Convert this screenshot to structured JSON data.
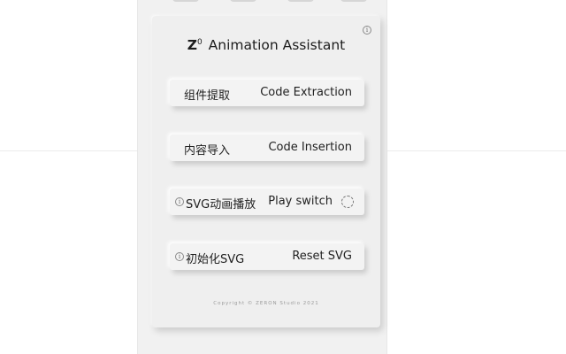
{
  "panel": {
    "logo": "Z",
    "logo_sup": "0",
    "title": "Animation Assistant",
    "info_icon": "info-icon",
    "copyright": "Copyright © ZERON Studio 2021"
  },
  "buttons": [
    {
      "cn": "组件提取",
      "en": "Code Extraction"
    },
    {
      "cn": "内容导入",
      "en": "Code Insertion"
    },
    {
      "cn": "SVG动画播放",
      "en": "Play switch",
      "icon": "info-icon",
      "toggle_icon": "spinner-icon"
    },
    {
      "cn": "初始化SVG",
      "en": "Reset SVG",
      "icon": "info-icon"
    }
  ],
  "colors": {
    "panel_bg": "#efefef",
    "text": "#1f1f1f",
    "backdrop": "#f1f1f1"
  }
}
